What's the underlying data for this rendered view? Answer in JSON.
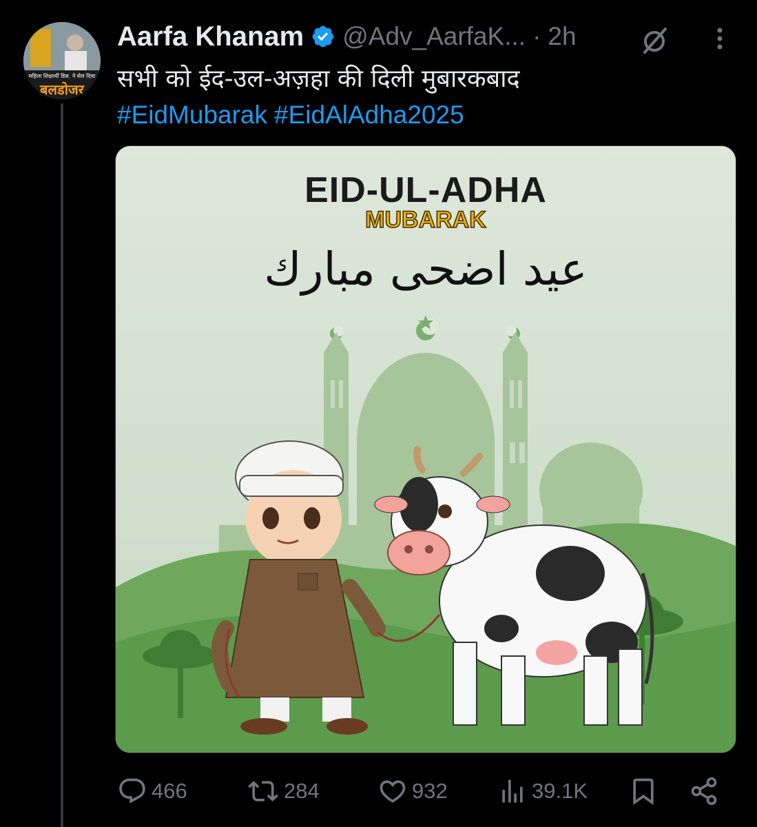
{
  "author": {
    "display_name": "Aarfa Khanam",
    "handle": "@Adv_AarfaK...",
    "separator": "·",
    "time": "2h",
    "avatar_caption": "महिला शिक्षार्थी  डिस. ने सेल दिया",
    "avatar_title": "बलडोजर"
  },
  "tweet": {
    "text": "सभी को ईद-उल-अज़हा की दिली मुबारकबाद",
    "hashtags": [
      "#EidMubarak",
      "#EidAlAdha2025"
    ]
  },
  "media": {
    "title": "EID-UL-ADHA",
    "subtitle": "MUBARAK",
    "arabic": "عيد اضحى مبارك"
  },
  "actions": {
    "replies": "466",
    "retweets": "284",
    "likes": "932",
    "views": "39.1K"
  },
  "icons": [
    "verified-icon",
    "grok-icon",
    "more-icon",
    "reply-icon",
    "retweet-icon",
    "like-icon",
    "views-icon",
    "bookmark-icon",
    "share-icon"
  ],
  "colors": {
    "accent": "#1d9bf0",
    "muted": "#71767b",
    "text": "#e7e9ea",
    "background": "#000000"
  }
}
